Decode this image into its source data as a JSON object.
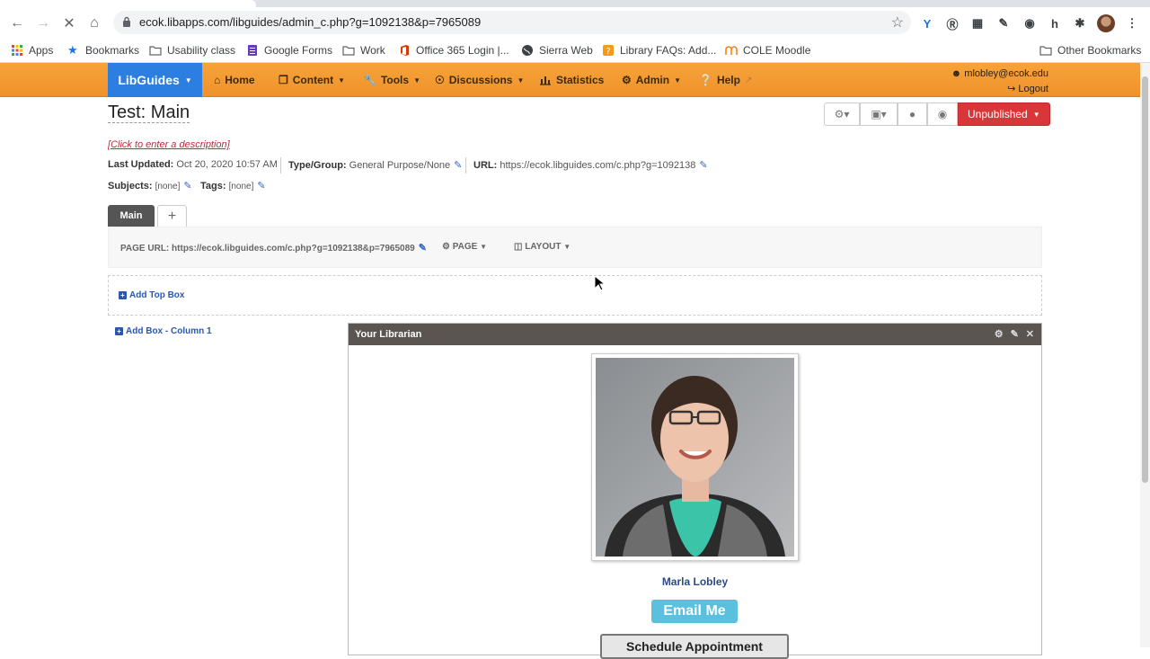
{
  "browser": {
    "url": "ecok.libapps.com/libguides/admin_c.php?g=1092138&p=7965089",
    "bookmarks": [
      {
        "label": "Apps",
        "icon": "apps-grid-icon"
      },
      {
        "label": "Bookmarks",
        "icon": "star-icon"
      },
      {
        "label": "Usability class",
        "icon": "folder-icon"
      },
      {
        "label": "Google Forms",
        "icon": "google-forms-icon"
      },
      {
        "label": "Work",
        "icon": "folder-icon"
      },
      {
        "label": "Office 365 Login |...",
        "icon": "office-icon"
      },
      {
        "label": "Sierra Web",
        "icon": "globe-icon"
      },
      {
        "label": "Library FAQs: Add...",
        "icon": "libanswers-icon"
      },
      {
        "label": "COLE Moodle",
        "icon": "moodle-icon"
      }
    ],
    "other_bookmarks": "Other Bookmarks"
  },
  "navbar": {
    "brand": "LibGuides",
    "items": [
      {
        "label": "Home",
        "icon": "home-icon"
      },
      {
        "label": "Content",
        "icon": "content-icon"
      },
      {
        "label": "Tools",
        "icon": "wrench-icon"
      },
      {
        "label": "Discussions",
        "icon": "comments-icon"
      },
      {
        "label": "Statistics",
        "icon": "bar-chart-icon"
      },
      {
        "label": "Admin",
        "icon": "admin-icon"
      },
      {
        "label": "Help",
        "icon": "help-icon"
      }
    ],
    "user_email": "mlobley@ecok.edu",
    "logout": "Logout"
  },
  "guide": {
    "title": "Test: Main",
    "description_placeholder": "[Click to enter a description]",
    "last_updated_label": "Last Updated:",
    "last_updated": "Oct 20, 2020 10:57 AM",
    "type_group_label": "Type/Group:",
    "type_group": "General Purpose/None",
    "url_label": "URL:",
    "url": "https://ecok.libguides.com/c.php?g=1092138",
    "subjects_label": "Subjects:",
    "subjects": "[none]",
    "tags_label": "Tags:",
    "tags": "[none]",
    "status": "Unpublished"
  },
  "tabs": {
    "main": "Main",
    "add": "+"
  },
  "pagebar": {
    "page_url_label": "PAGE URL:",
    "page_url": "https://ecok.libguides.com/c.php?g=1092138&p=7965089",
    "page_menu": "PAGE",
    "layout_menu": "LAYOUT"
  },
  "boxes": {
    "add_top_box": "Add Top Box",
    "add_box_col1": "Add Box - Column 1",
    "librarian_title": "Your Librarian",
    "librarian_name": "Marla Lobley",
    "email_button": "Email Me",
    "schedule_button": "Schedule Appointment"
  },
  "colors": {
    "navbar_orange": "#f0922b",
    "brand_blue": "#2c7fe0",
    "unpublished_red": "#d9363a",
    "email_button": "#5bc0de"
  }
}
